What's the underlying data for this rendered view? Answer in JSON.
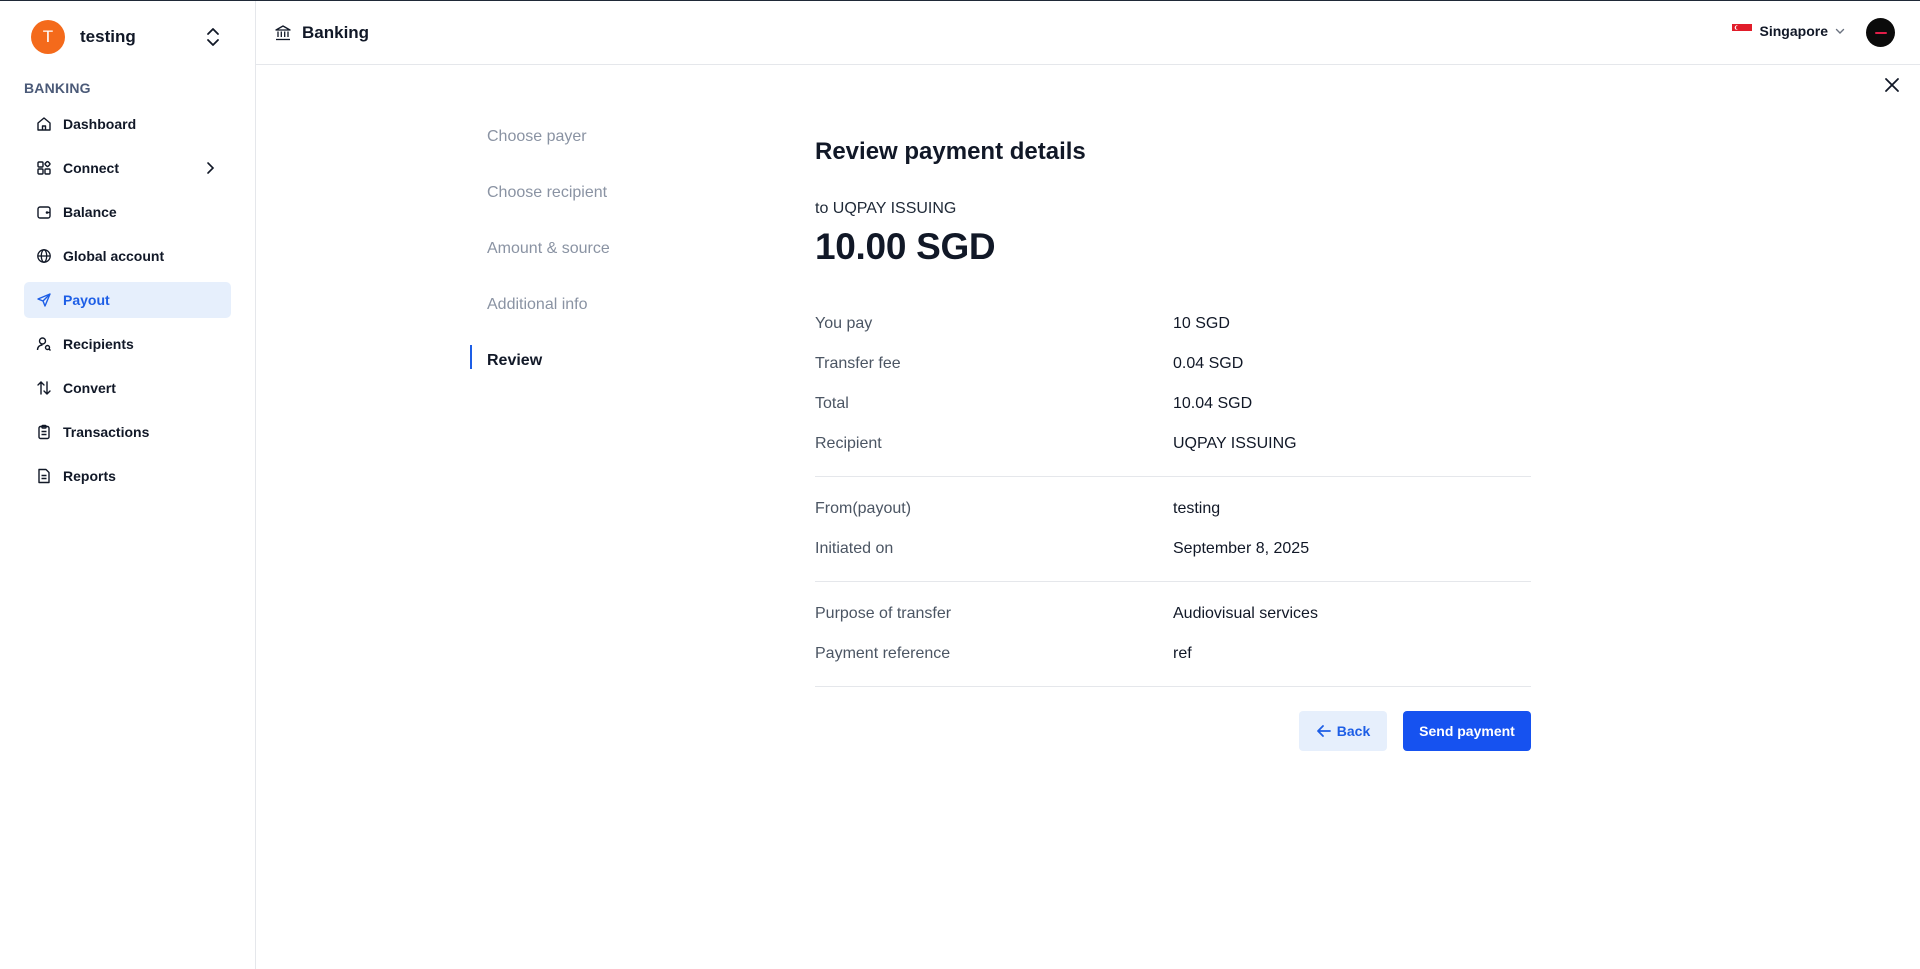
{
  "sidebar": {
    "org": {
      "initial": "T",
      "name": "testing"
    },
    "section_label": "BANKING",
    "items": [
      {
        "label": "Dashboard",
        "icon": "home-icon"
      },
      {
        "label": "Connect",
        "icon": "connect-icon"
      },
      {
        "label": "Balance",
        "icon": "wallet-icon"
      },
      {
        "label": "Global account",
        "icon": "globe-icon"
      },
      {
        "label": "Payout",
        "icon": "send-icon",
        "active": true
      },
      {
        "label": "Recipients",
        "icon": "user-search-icon"
      },
      {
        "label": "Convert",
        "icon": "convert-arrows-icon"
      },
      {
        "label": "Transactions",
        "icon": "clipboard-icon"
      },
      {
        "label": "Reports",
        "icon": "document-icon"
      }
    ]
  },
  "header": {
    "title": "Banking",
    "region": "Singapore"
  },
  "stepper": {
    "steps": [
      "Choose payer",
      "Choose recipient",
      "Amount & source",
      "Additional info",
      "Review"
    ],
    "current": "Review"
  },
  "review": {
    "title": "Review payment details",
    "to_line": "to UQPAY ISSUING",
    "amount": "10.00 SGD",
    "groups": [
      [
        {
          "label": "You pay",
          "value": "10 SGD"
        },
        {
          "label": "Transfer fee",
          "value": "0.04 SGD"
        },
        {
          "label": "Total",
          "value": "10.04 SGD"
        },
        {
          "label": "Recipient",
          "value": "UQPAY ISSUING"
        }
      ],
      [
        {
          "label": "From(payout)",
          "value": "testing"
        },
        {
          "label": "Initiated on",
          "value": "September 8, 2025"
        }
      ],
      [
        {
          "label": "Purpose of transfer",
          "value": "Audiovisual services"
        },
        {
          "label": "Payment reference",
          "value": "ref"
        }
      ]
    ],
    "back_label": "Back",
    "send_label": "Send payment"
  },
  "colors": {
    "accent": "#1d5ee6",
    "primary_button": "#1652f0",
    "active_nav_bg": "#e6effc",
    "org_avatar": "#f46a1b"
  }
}
